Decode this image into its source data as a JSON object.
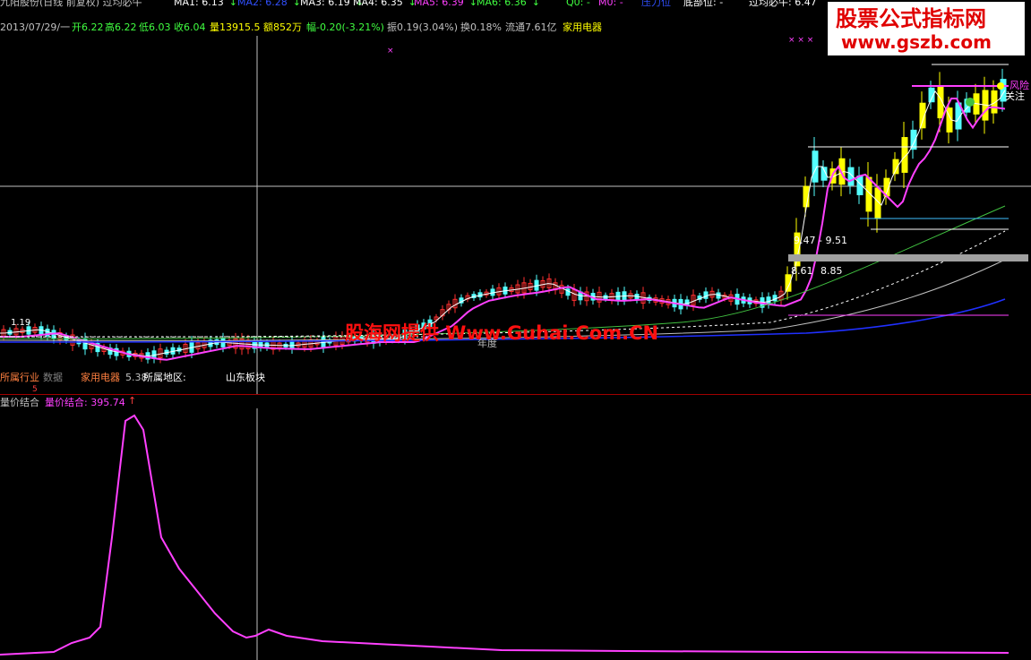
{
  "topbar": {
    "title": "九阳股份(日线 前复权) 过均必牛",
    "indicators": [
      {
        "label": "MA1: 6.13",
        "color": "#ffffff"
      },
      {
        "label": "MA2: 6.28",
        "color": "#3050ff"
      },
      {
        "label": "MA3: 6.19",
        "color": "#ffffff"
      },
      {
        "label": "MA4: 6.35",
        "color": "#ffffff"
      },
      {
        "label": "MA5: 6.39",
        "color": "#ff40ff"
      },
      {
        "label": "MA6: 6.36",
        "color": "#40ff40"
      },
      {
        "label": "Q0: -",
        "color": "#40ff40"
      },
      {
        "label": "M0: -",
        "color": "#ff40ff"
      },
      {
        "label": "压力位",
        "color": "#3050ff"
      },
      {
        "label": "底部位: -",
        "color": "#ffffff"
      },
      {
        "label": "过均必牛: 6.47",
        "color": "#ffffff"
      }
    ],
    "arrow": "↓"
  },
  "infobar": {
    "date": "2013/07/29/一",
    "open": "开6.22",
    "high": "高6.22",
    "low": "低6.03",
    "close": "收6.04",
    "volume": "量13915.5",
    "amount": "额852万",
    "change": "幅-0.20(-3.21%)",
    "amplitude": "振0.19(3.04%)",
    "turnover": "换0.18%",
    "float_cap": "流通7.61亿",
    "industry": "家用电器"
  },
  "main_chart": {
    "markers": {
      "m1": "1.19",
      "m2": "9.47 - 9.51",
      "m3": "8.61",
      "m4": "8.85",
      "m5": "年度",
      "m6": "关注",
      "m7": "风险",
      "marks": "× × ×"
    },
    "info_row": {
      "industry_label": "所属行业",
      "data_label": "数据",
      "industry_value": "家用电器",
      "industry_num": "5.38",
      "region_label": "所属地区:",
      "region_value": "山东板块",
      "small_mark": "5"
    }
  },
  "sub_chart": {
    "name": "量价结合",
    "value_label": "量价结合: 395.74",
    "arrow": "↑"
  },
  "watermark": "股海网提供 Www.Guhai.Com.CN",
  "logo": {
    "line1": "股票公式指标网",
    "line2": "www.gszb.com"
  },
  "colors": {
    "up": "#ff3030",
    "down": "#54ffff",
    "yellow": "#ffff00",
    "magenta": "#ff40ff",
    "green": "#40c040",
    "blue": "#2030ff",
    "divider": "#a00000"
  }
}
